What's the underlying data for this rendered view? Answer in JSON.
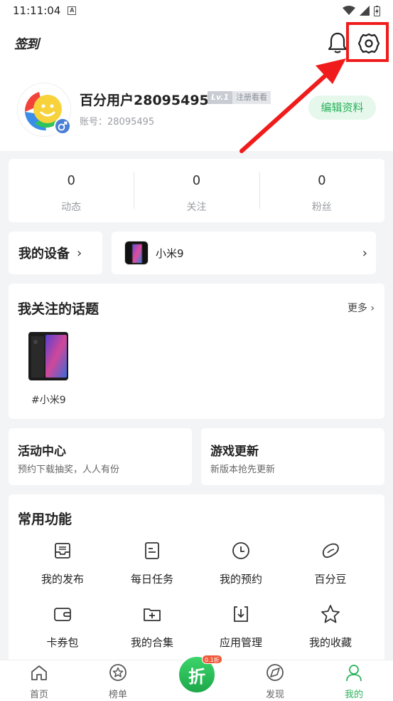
{
  "status_bar": {
    "time": "11:11:04",
    "a_icon": "A"
  },
  "header": {
    "checkin_label": "签到",
    "bell_icon": "bell-icon",
    "settings_icon": "gear-icon"
  },
  "profile": {
    "username": "百分用户28095495",
    "level": "Lv.1",
    "register_hint": "注册看看",
    "account": "账号：28095495",
    "edit_button": "编辑资料"
  },
  "stats": [
    {
      "value": "0",
      "label": "动态"
    },
    {
      "value": "0",
      "label": "关注"
    },
    {
      "value": "0",
      "label": "粉丝"
    }
  ],
  "device": {
    "title": "我的设备",
    "chevron": "›",
    "phone_name": "小米9"
  },
  "topics": {
    "title": "我关注的话题",
    "more": "更多 ›",
    "items": [
      {
        "label": "#小米9"
      }
    ]
  },
  "features": [
    {
      "title": "活动中心",
      "subtitle": "预约下载抽奖，人人有份"
    },
    {
      "title": "游戏更新",
      "subtitle": "新版本抢先更新"
    }
  ],
  "common": {
    "title": "常用功能",
    "items": [
      {
        "label": "我的发布",
        "icon": "inbox-icon"
      },
      {
        "label": "每日任务",
        "icon": "task-list-icon"
      },
      {
        "label": "我的预约",
        "icon": "clock-icon"
      },
      {
        "label": "百分豆",
        "icon": "bean-icon"
      },
      {
        "label": "卡券包",
        "icon": "wallet-icon"
      },
      {
        "label": "我的合集",
        "icon": "folder-add-icon"
      },
      {
        "label": "应用管理",
        "icon": "download-box-icon"
      },
      {
        "label": "我的收藏",
        "icon": "star-icon"
      }
    ]
  },
  "bottom_nav": {
    "items": [
      {
        "label": "首页",
        "icon": "home-icon"
      },
      {
        "label": "榜单",
        "icon": "star-badge-icon"
      },
      {
        "label": "发现",
        "icon": "compass-icon"
      },
      {
        "label": "我的",
        "icon": "user-icon",
        "active": true
      }
    ],
    "center_label": "折",
    "center_badge": "0.1折"
  },
  "colors": {
    "accent": "#2bb35c",
    "highlight": "#f01c1c"
  }
}
